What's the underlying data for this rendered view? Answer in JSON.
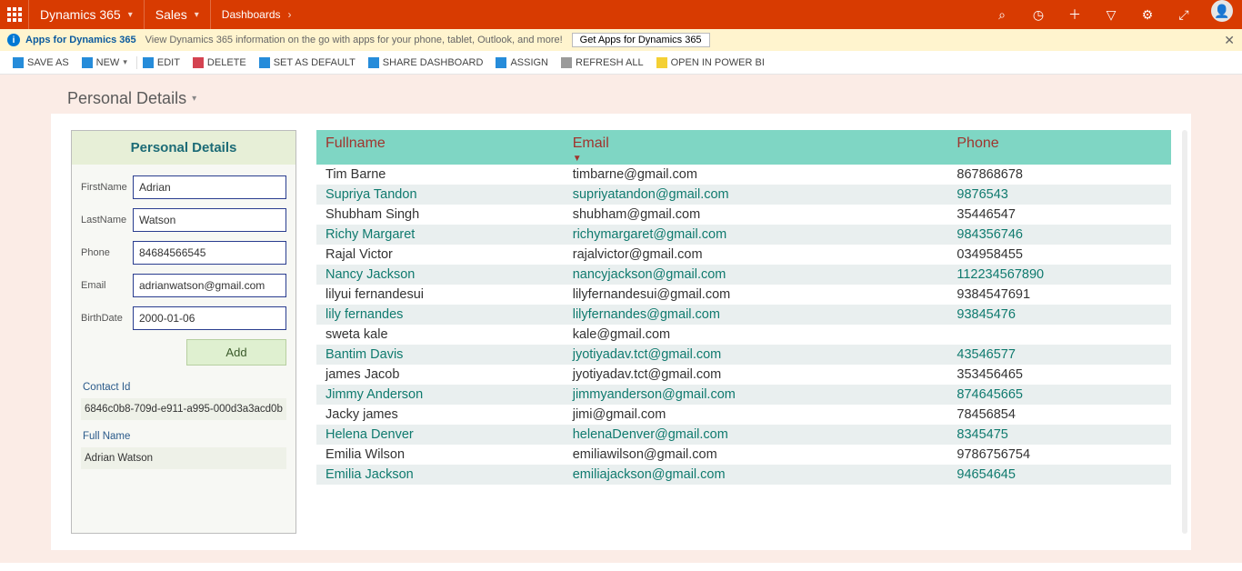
{
  "topnav": {
    "brand": "Dynamics 365",
    "module": "Sales",
    "crumb": "Dashboards"
  },
  "infobar": {
    "link": "Apps for Dynamics 365",
    "desc": "View Dynamics 365 information on the go with apps for your phone, tablet, Outlook, and more!",
    "button": "Get Apps for Dynamics 365"
  },
  "commands": {
    "save_as": "SAVE AS",
    "new": "NEW",
    "edit": "EDIT",
    "delete": "DELETE",
    "set_default": "SET AS DEFAULT",
    "share": "SHARE DASHBOARD",
    "assign": "ASSIGN",
    "refresh": "REFRESH ALL",
    "powerbi": "OPEN IN POWER BI"
  },
  "page_title": "Personal Details",
  "form": {
    "header": "Personal Details",
    "labels": {
      "first": "FirstName",
      "last": "LastName",
      "phone": "Phone",
      "email": "Email",
      "birth": "BirthDate"
    },
    "values": {
      "first": "Adrian",
      "last": "Watson",
      "phone": "84684566545",
      "email": "adrianwatson@gmail.com",
      "birth": "2000-01-06"
    },
    "add_label": "Add",
    "contact_id_label": "Contact Id",
    "contact_id_value": "6846c0b8-709d-e911-a995-000d3a3acd0b",
    "fullname_label": "Full Name",
    "fullname_value": "Adrian Watson"
  },
  "table": {
    "headers": {
      "fullname": "Fullname",
      "email": "Email",
      "phone": "Phone"
    },
    "rows": [
      {
        "name": "Tim Barne",
        "email": "timbarne@gmail.com",
        "phone": "867868678"
      },
      {
        "name": "Supriya Tandon",
        "email": "supriyatandon@gmail.com",
        "phone": "9876543"
      },
      {
        "name": "Shubham Singh",
        "email": "shubham@gmail.com",
        "phone": "35446547"
      },
      {
        "name": "Richy Margaret",
        "email": "richymargaret@gmail.com",
        "phone": "984356746"
      },
      {
        "name": "Rajal Victor",
        "email": "rajalvictor@gmail.com",
        "phone": "034958455"
      },
      {
        "name": "Nancy Jackson",
        "email": "nancyjackson@gmail.com",
        "phone": "112234567890"
      },
      {
        "name": "lilyui fernandesui",
        "email": "lilyfernandesui@gmail.com",
        "phone": "9384547691"
      },
      {
        "name": "lily fernandes",
        "email": "lilyfernandes@gmail.com",
        "phone": "93845476"
      },
      {
        "name": "sweta kale",
        "email": "kale@gmail.com",
        "phone": ""
      },
      {
        "name": "Bantim Davis",
        "email": "jyotiyadav.tct@gmail.com",
        "phone": "43546577"
      },
      {
        "name": "james Jacob",
        "email": "jyotiyadav.tct@gmail.com",
        "phone": "353456465"
      },
      {
        "name": "Jimmy Anderson",
        "email": "jimmyanderson@gmail.com",
        "phone": "874645665"
      },
      {
        "name": "Jacky james",
        "email": "jimi@gmail.com",
        "phone": "78456854"
      },
      {
        "name": "Helena Denver",
        "email": "helenaDenver@gmail.com",
        "phone": "8345475"
      },
      {
        "name": "Emilia Wilson",
        "email": "emiliawilson@gmail.com",
        "phone": "9786756754"
      },
      {
        "name": "Emilia Jackson",
        "email": "emiliajackson@gmail.com",
        "phone": "94654645"
      }
    ]
  }
}
